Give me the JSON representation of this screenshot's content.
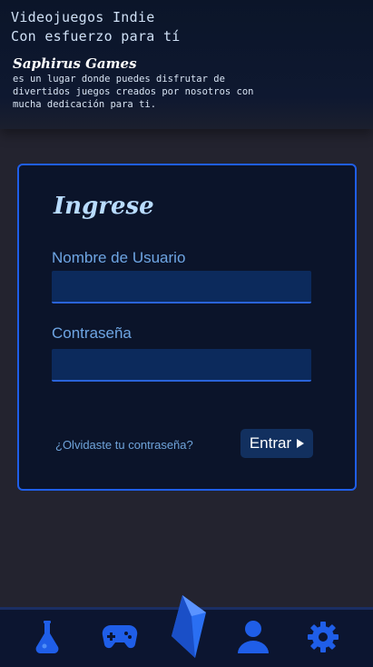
{
  "header": {
    "tagline_line1": "Videojuegos Indie",
    "tagline_line2": "Con esfuerzo para tí",
    "brand": "Saphirus Games",
    "description": "es un lugar donde puedes disfrutar de divertidos juegos creados por nosotros con mucha dedicación para ti."
  },
  "login": {
    "title": "Ingrese",
    "username_label": "Nombre de Usuario",
    "username_value": "",
    "password_label": "Contraseña",
    "password_value": "",
    "forgot_label": "¿Olvidaste tu contraseña?",
    "submit_label": "Entrar"
  },
  "nav": {
    "items": [
      {
        "icon": "potion-icon"
      },
      {
        "icon": "gamepad-icon"
      },
      {
        "icon": "crystal-icon"
      },
      {
        "icon": "user-icon"
      },
      {
        "icon": "gear-icon"
      }
    ]
  },
  "colors": {
    "accent": "#1f5ee8",
    "header_bg": "#0b1529",
    "card_bg": "#0b142a",
    "nav_bg": "#0c1530",
    "page_bg": "#23232f"
  }
}
